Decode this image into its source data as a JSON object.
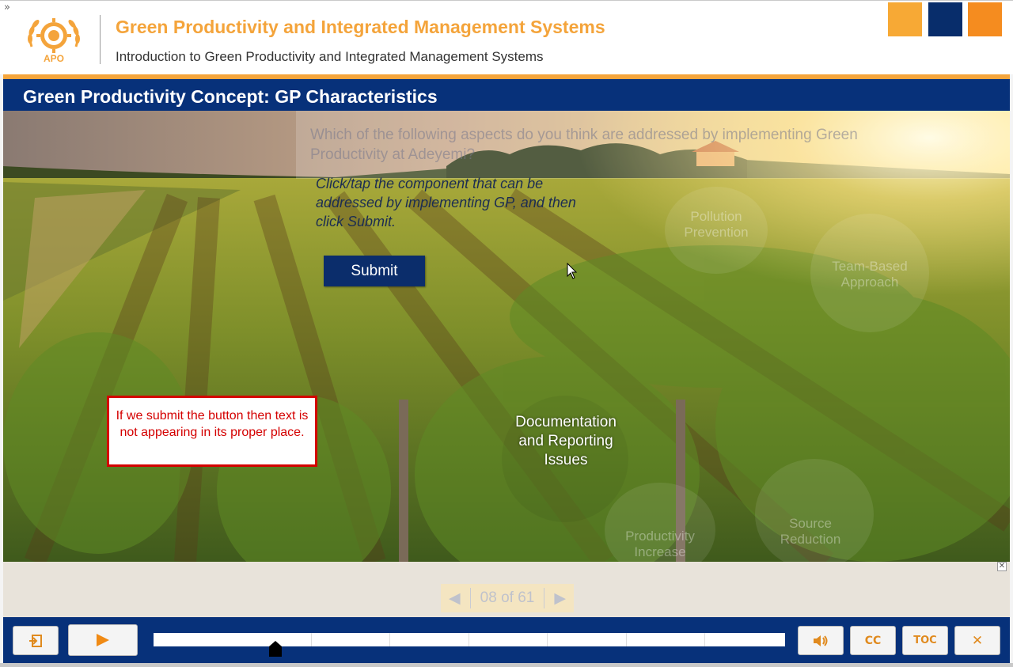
{
  "header": {
    "expand_glyph": "»",
    "logo_text": "APO",
    "course_title": "Green Productivity and Integrated Management Systems",
    "course_subtitle": "Introduction to Green Productivity and Integrated Management Systems",
    "squares": [
      "#f7a935",
      "#082d6b",
      "#f58c1f"
    ]
  },
  "slide": {
    "title": "Green Productivity Concept: GP Characteristics",
    "question": "Which of the following aspects do you think are addressed by implementing Green Productivity at Adeyemi?",
    "instruction": "Click/tap the component that can be addressed by implementing GP, and then click Submit.",
    "submit_label": "Submit",
    "components": {
      "pollution_prevention": "Pollution Prevention",
      "team_based": "Team-Based Approach",
      "documentation": "Documentation and Reporting Issues",
      "productivity": "Productivity Increase",
      "source_reduction": "Source Reduction"
    },
    "note": "If we submit the button then text is not appearing in its proper place."
  },
  "pager": {
    "prev_glyph": "◀",
    "label": "08 of 61",
    "next_glyph": "▶"
  },
  "playbar": {
    "exit_icon": "exit-icon",
    "play_icon": "play-icon",
    "volume_icon": "volume-icon",
    "cc_label": "CC",
    "toc_label": "TOC",
    "close_glyph": "✕",
    "progress_fraction": 0.2
  },
  "colors": {
    "accent_orange": "#f5a53c",
    "navy": "#07317a",
    "note_red": "#d40000"
  }
}
